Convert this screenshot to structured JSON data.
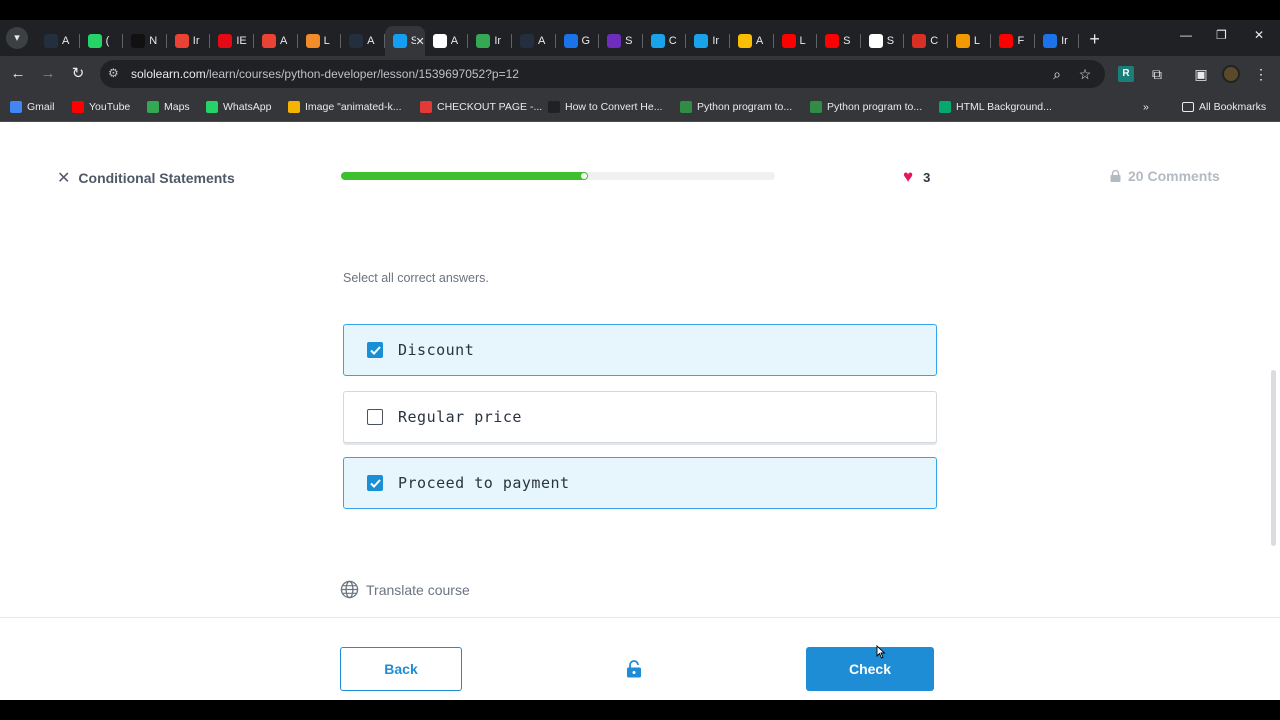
{
  "browser": {
    "tabs": [
      {
        "title": "A",
        "icon": "aws-icon",
        "color": "#232f3e"
      },
      {
        "title": "(",
        "icon": "whatsapp-icon",
        "color": "#25d366"
      },
      {
        "title": "N",
        "icon": "notion-icon",
        "color": "#111111"
      },
      {
        "title": "Ir",
        "icon": "gmail-icon",
        "color": "#ea4335"
      },
      {
        "title": "IE",
        "icon": "netflix-icon",
        "color": "#e50914"
      },
      {
        "title": "A",
        "icon": "gmail-icon",
        "color": "#ea4335"
      },
      {
        "title": "L",
        "icon": "box-icon",
        "color": "#f28c28"
      },
      {
        "title": "A",
        "icon": "aws-icon",
        "color": "#232f3e"
      },
      {
        "title": "S",
        "icon": "sololearn-icon",
        "color": "#149ef2",
        "active": true
      },
      {
        "title": "A",
        "icon": "sheets-icon",
        "color": "#ffffff"
      },
      {
        "title": "Ir",
        "icon": "sheets-plus-icon",
        "color": "#34a853"
      },
      {
        "title": "A",
        "icon": "aws-icon",
        "color": "#232f3e"
      },
      {
        "title": "G",
        "icon": "c-icon",
        "color": "#1a73e8"
      },
      {
        "title": "S",
        "icon": "u-icon",
        "color": "#6f2dbd"
      },
      {
        "title": "C",
        "icon": "ist-icon",
        "color": "#1aa3e8"
      },
      {
        "title": "Ir",
        "icon": "ist-icon",
        "color": "#1aa3e8"
      },
      {
        "title": "A",
        "icon": "drive-icon",
        "color": "#fbbc04"
      },
      {
        "title": "L",
        "icon": "youtube-icon",
        "color": "#ff0000"
      },
      {
        "title": "S",
        "icon": "youtube-icon",
        "color": "#ff0000"
      },
      {
        "title": "S",
        "icon": "doc-icon",
        "color": "#ffffff"
      },
      {
        "title": "C",
        "icon": "record-icon",
        "color": "#d93025"
      },
      {
        "title": "L",
        "icon": "circle-icon",
        "color": "#f29900"
      },
      {
        "title": "F",
        "icon": "youtube-icon",
        "color": "#ff0000"
      },
      {
        "title": "Ir",
        "icon": "ext-icon",
        "color": "#1a73e8"
      }
    ],
    "active_tab_title": "S",
    "url_host": "sololearn.com",
    "url_path": "/learn/courses/python-developer/lesson/1539697052?p=12",
    "bookmarks": [
      {
        "label": "Gmail",
        "icon": "docs-icon",
        "color": "#4285f4"
      },
      {
        "label": "YouTube",
        "icon": "youtube-icon",
        "color": "#ff0000"
      },
      {
        "label": "Maps",
        "icon": "maps-icon",
        "color": "#34a853"
      },
      {
        "label": "WhatsApp",
        "icon": "whatsapp-icon",
        "color": "#25d366"
      },
      {
        "label": "Image \"animated-k...",
        "icon": "star-icon",
        "color": "#f4b400"
      },
      {
        "label": "CHECKOUT PAGE -...",
        "icon": "shoe-icon",
        "color": "#e53935"
      },
      {
        "label": "How to Convert He...",
        "icon": "alpha-icon",
        "color": "#202124"
      },
      {
        "label": "Python program to...",
        "icon": "gfg-icon",
        "color": "#2f8d46"
      },
      {
        "label": "Python program to...",
        "icon": "gfg-icon",
        "color": "#2f8d46"
      },
      {
        "label": "HTML Background...",
        "icon": "w3-icon",
        "color": "#04aa6d"
      }
    ],
    "all_bookmarks_label": "All Bookmarks"
  },
  "lesson": {
    "title": "Conditional Statements",
    "progress": 0.57,
    "hearts": "3",
    "comments": "20 Comments",
    "instruction": "Select all correct answers.",
    "options": [
      {
        "label": "Discount",
        "checked": true
      },
      {
        "label": "Regular price",
        "checked": false
      },
      {
        "label": "Proceed to payment",
        "checked": true
      }
    ],
    "translate_label": "Translate course",
    "back_label": "Back",
    "check_label": "Check"
  },
  "colors": {
    "accent": "#1f8dd6",
    "progress": "#3ec02e",
    "heart": "#e3175b",
    "selected_bg": "#e7f5fd"
  }
}
